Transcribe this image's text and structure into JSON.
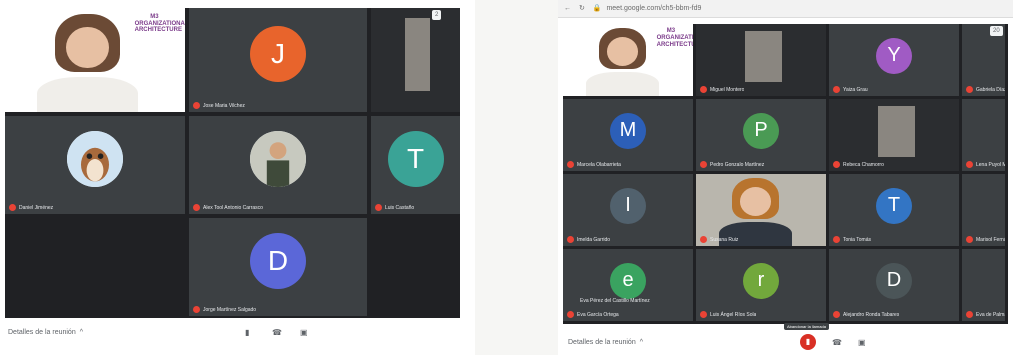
{
  "left_meeting": {
    "badge": "2",
    "tiles": [
      {
        "type": "speaker",
        "name": "",
        "logo": "M3 ORGANIZATIONAL ARCHITECTURE"
      },
      {
        "type": "avatar",
        "letter": "J",
        "color": "#e8642c",
        "name": "Jose Maria Vilchez"
      },
      {
        "type": "photo",
        "name": ""
      },
      {
        "type": "photo-cartoon",
        "name": "Daniel Jiménez"
      },
      {
        "type": "photo-person",
        "name": "Alex Tool Antonio Carrasco"
      },
      {
        "type": "avatar",
        "letter": "T",
        "color": "#3aa396",
        "name": "Luis Castaño"
      },
      {
        "type": "empty",
        "name": ""
      },
      {
        "type": "avatar",
        "letter": "D",
        "color": "#5b67d8",
        "name": "Jorge Martínez Salgado"
      },
      {
        "type": "empty",
        "name": ""
      }
    ],
    "bottom": {
      "details": "Detalles de la reunión",
      "chevron": "^"
    }
  },
  "right_meeting": {
    "url": "meet.google.com/ch5-bbm-fd9",
    "badge": "20",
    "tiles": [
      {
        "type": "speaker",
        "name": "",
        "logo": "M3 ORGANIZATIONAL ARCHITECTURE"
      },
      {
        "type": "photo",
        "name": "Miguel Montero"
      },
      {
        "type": "avatar",
        "letter": "Y",
        "color": "#a05bc4",
        "name": "Yaiza Grau"
      },
      {
        "type": "edge",
        "name": "Gabriela Díaz García"
      },
      {
        "type": "avatar",
        "letter": "M",
        "color": "#2c5fb8",
        "name": "Marcela Olabarrieta"
      },
      {
        "type": "avatar",
        "letter": "P",
        "color": "#4a9a54",
        "name": "Pedro Gonzalo Martínez"
      },
      {
        "type": "photo-portrait",
        "name": "Rebeca Chamorro"
      },
      {
        "type": "edge",
        "name": "Lena Puyol Martínez"
      },
      {
        "type": "avatar",
        "letter": "I",
        "color": "#51616d",
        "name": "Imelda Garrido"
      },
      {
        "type": "video",
        "name": "Susana Ruiz"
      },
      {
        "type": "avatar",
        "letter": "T",
        "color": "#3375c4",
        "name": "Tonia Tomás"
      },
      {
        "type": "edge",
        "name": "Marisol Fernández"
      },
      {
        "type": "avatar",
        "letter": "e",
        "color": "#3aa360",
        "name": "Eva García Ortega"
      },
      {
        "type": "avatar",
        "letter": "r",
        "color": "#72a83c",
        "name": "Luis Ángel Ríos Sola"
      },
      {
        "type": "avatar",
        "letter": "D",
        "color": "#4b5558",
        "name": "Alejandro Ronda Tabares"
      },
      {
        "type": "edge",
        "name": "Eva de Palma"
      }
    ],
    "overlay_caption": "Eva Pérez del Castillo Martínez",
    "bottom": {
      "details": "Detalles de la reunión",
      "chevron": "^",
      "tooltip": "Abandonar la llamada"
    }
  }
}
